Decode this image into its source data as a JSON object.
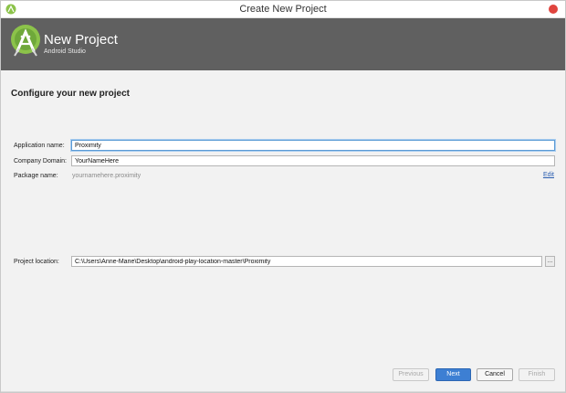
{
  "window": {
    "title": "Create New Project"
  },
  "banner": {
    "title": "New Project",
    "subtitle": "Android Studio"
  },
  "page": {
    "heading": "Configure your new project"
  },
  "form": {
    "app_name_label": "Application name:",
    "app_name_value": "Proximity",
    "company_domain_label": "Company Domain:",
    "company_domain_value": "YourNameHere",
    "package_name_label": "Package name:",
    "package_name_value": "yournamehere.proximity",
    "edit_link": "Edit",
    "project_location_label": "Project location:",
    "project_location_value": "C:\\Users\\Anne-Marie\\Desktop\\android-play-location-master\\Proximity",
    "browse_label": "..."
  },
  "buttons": {
    "previous": "Previous",
    "next": "Next",
    "cancel": "Cancel",
    "finish": "Finish"
  },
  "colors": {
    "banner_bg": "#606060",
    "primary_button": "#3d7fd3",
    "close_button": "#e0443e",
    "android_green": "#8cc34a",
    "link": "#2a5db0"
  },
  "icons": {
    "app": "android-studio-icon",
    "logo": "android-studio-logo",
    "close": "close-icon"
  }
}
